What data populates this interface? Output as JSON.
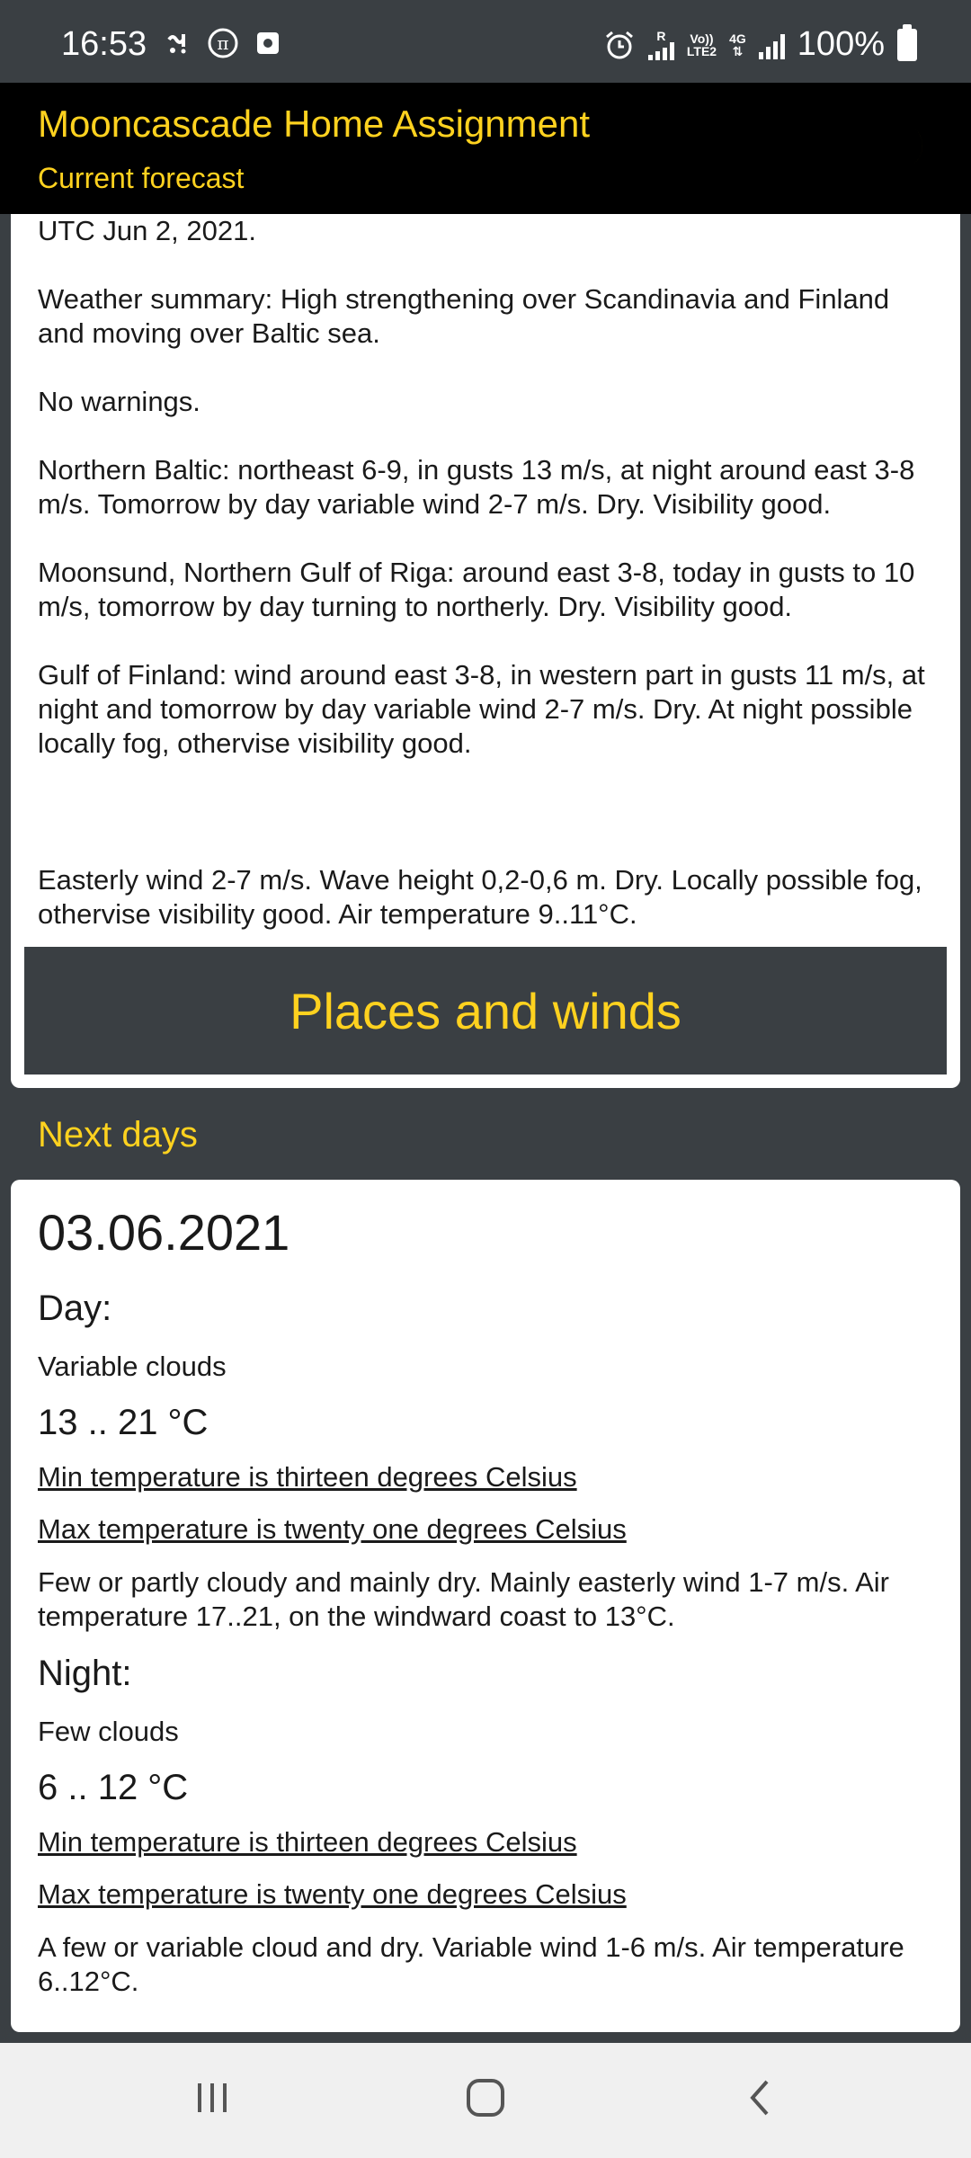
{
  "status_bar": {
    "time": "16:53",
    "battery": "100%",
    "network_line1": "Vo))",
    "network_line2": "LTE2",
    "network_type": "4G",
    "sim_label": "R",
    "left_icons": [
      "wind-notification-icon",
      "pi-app-icon",
      "square-notification-icon"
    ],
    "right_icons": [
      "alarm-icon",
      "signal-icon",
      "signal-icon",
      "battery-icon"
    ]
  },
  "app_bar": {
    "title": "Mooncascade Home Assignment",
    "subtitle": "Current forecast",
    "theme_icon": "moon-icon",
    "accent_color": "#ffd21f"
  },
  "current": {
    "paragraphs": [
      "UTC Jun 2, 2021.",
      "Weather summary: High strengthening over Scandinavia and Finland\nand moving over Baltic sea.",
      "No warnings.",
      "Northern Baltic: northeast 6-9, in gusts 13 m/s, at night around east 3-8\nm/s. Tomorrow by day variable wind 2-7 m/s. Dry. Visibility good.",
      "Moonsund, Northern Gulf of Riga: around east 3-8, today in gusts to 10\nm/s, tomorrow by day turning to northerly. Dry. Visibility good.",
      "Gulf of Finland: wind around east 3-8, in western part in gusts 11 m/s, at\nnight and tomorrow by day variable wind 2-7 m/s.  Dry. At night possible\nlocally fog, othervise visibility good.",
      "",
      "Easterly wind 2-7 m/s. Wave height 0,2-0,6 m. Dry. Locally possible fog,\nothervise visibility good. Air temperature 9..11°C."
    ],
    "places_button": "Places and winds"
  },
  "next_days": {
    "header": "Next days",
    "day_card": {
      "date": "03.06.2021",
      "day": {
        "label": "Day:",
        "phenomenon": "Variable clouds",
        "temperature": "13 .. 21 °C",
        "min_text": "Min temperature is thirteen degrees Celsius",
        "max_text": "Max temperature is twenty one degrees Celsius",
        "description": "Few or partly cloudy and mainly dry. Mainly easterly wind 1-7 m/s. Air temperature 17..21, on the windward coast to 13°C."
      },
      "night": {
        "label": "Night:",
        "phenomenon": "Few clouds",
        "temperature": "6 .. 12 °C",
        "min_text": "Min temperature is thirteen degrees Celsius",
        "max_text": "Max temperature is twenty one degrees Celsius",
        "description": "A few or variable cloud and dry. Variable wind 1-6 m/s. Air temperature 6..12°C."
      }
    }
  },
  "nav_bar": {
    "icons": [
      "recent-apps-icon",
      "home-icon",
      "back-icon"
    ]
  }
}
